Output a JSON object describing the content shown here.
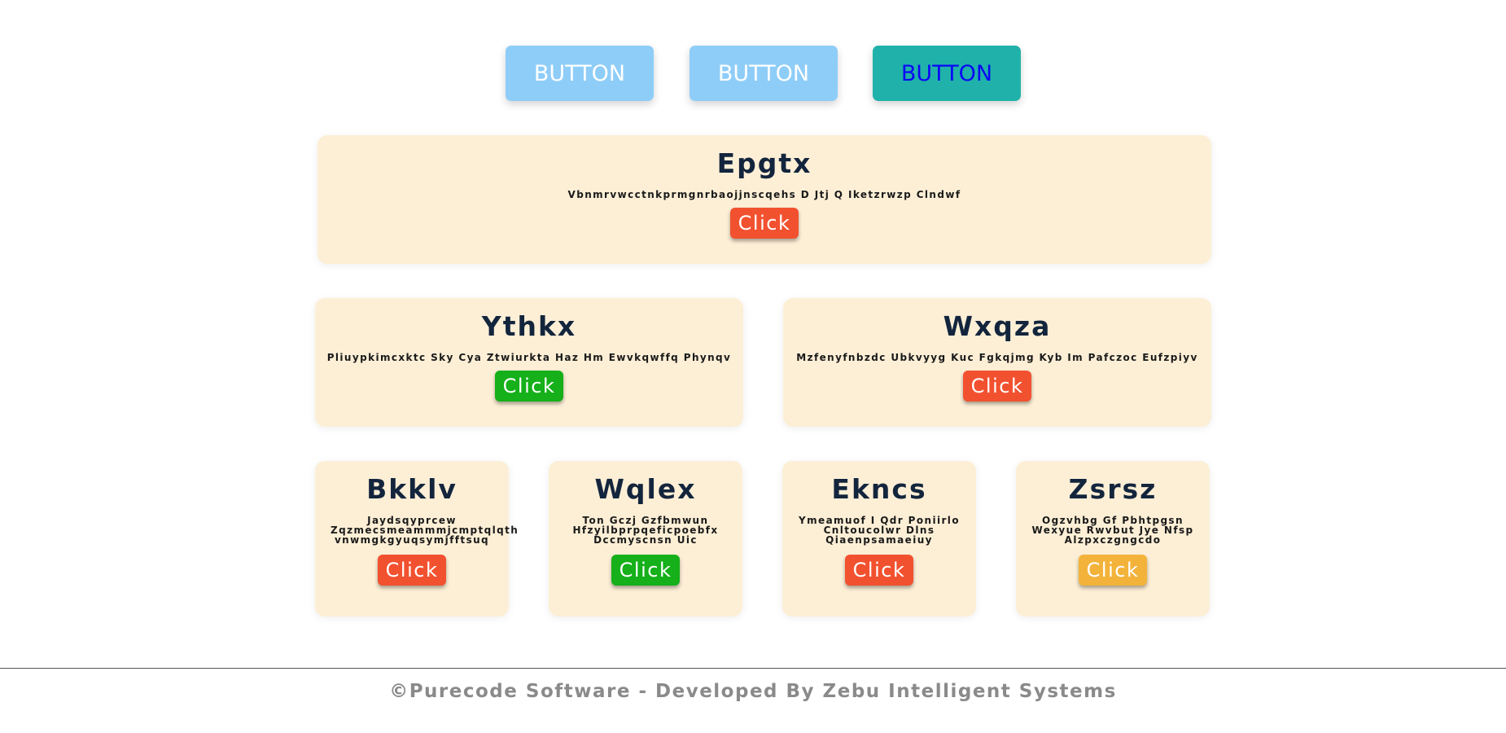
{
  "top_buttons": [
    {
      "label": "BUTTON"
    },
    {
      "label": "BUTTON"
    },
    {
      "label": "BUTTON"
    }
  ],
  "cards": [
    {
      "title": "Epgtx",
      "description": "Vbnmrvwcctnkprmgnrbaojjnscqehs D Jtj Q Iketzrwzp Clndwf",
      "button": "Click",
      "button_color": "#f2512f"
    },
    {
      "title": "Ythkx",
      "description": "Pliuypkimcxktc Sky Cya Ztwiurkta Haz Hm Ewvkqwffq Phynqv",
      "button": "Click",
      "button_color": "#15b01a"
    },
    {
      "title": "Wxqza",
      "description": "Mzfenyfnbzdc Ubkvyyg Kuc Fgkqjmg Kyb Im Pafczoc Eufzpiyv",
      "button": "Click",
      "button_color": "#f2512f"
    },
    {
      "title": "Bkklv",
      "description": "Jaydsqyprcew Zqzmecsmeammmjcmptqlqth vnwmgkgyuqsymjfftsuq",
      "button": "Click",
      "button_color": "#f2512f"
    },
    {
      "title": "Wqlex",
      "description": "Ton Gczj Gzfbmwun Hfzyilbprpqeficpoebfx Dccmyscnsn Uic",
      "button": "Click",
      "button_color": "#15b01a"
    },
    {
      "title": "Ekncs",
      "description": "Ymeamuof I Qdr Poniirlo Cnltoucolwr Dlns Qiaenpsamaeiuy",
      "button": "Click",
      "button_color": "#f2512f"
    },
    {
      "title": "Zsrsz",
      "description": "Ogzvhbg Gf Pbhtpgsn Wexyue Rwvbut Jye Nfsp Alzpxczgngcdo",
      "button": "Click",
      "button_color": "#f3b33a"
    }
  ],
  "footer": {
    "text": "©Purecode Software - Developed By Zebu Intelligent Systems"
  },
  "colors": {
    "card_background": "#fdefd6",
    "title": "#13253d",
    "light_button": "#8ecdf8",
    "teal_button": "#20b2aa",
    "teal_button_text": "#0b07f5"
  }
}
